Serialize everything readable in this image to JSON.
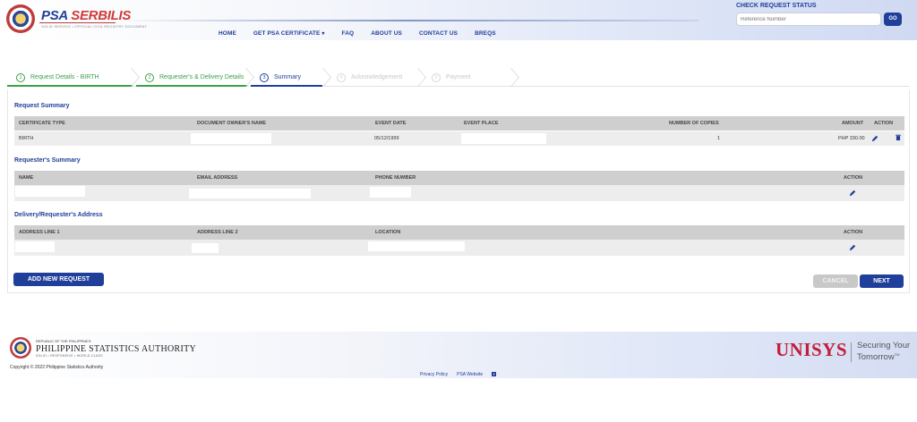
{
  "header": {
    "brand_psa": "PSA",
    "brand_serbilis": "SERBILIS",
    "brand_tagline": "SOLID SERVICE • OFFICIAL CIVIL REGISTRY DOCUMENT",
    "nav": [
      {
        "label": "HOME"
      },
      {
        "label": "GET PSA CERTIFICATE"
      },
      {
        "label": "FAQ"
      },
      {
        "label": "ABOUT US"
      },
      {
        "label": "CONTACT US"
      },
      {
        "label": "BREQS"
      }
    ],
    "check_status_title": "CHECK REQUEST STATUS",
    "reference_placeholder": "Reference Number",
    "go_label": "GO"
  },
  "steps": [
    {
      "num": "1",
      "label": "Request Details - BIRTH",
      "state": "done"
    },
    {
      "num": "2",
      "label": "Requester's & Delivery Details",
      "state": "done"
    },
    {
      "num": "3",
      "label": "Summary",
      "state": "active"
    },
    {
      "num": "4",
      "label": "Acknowledgement",
      "state": "pending"
    },
    {
      "num": "5",
      "label": "Payment",
      "state": "pending"
    }
  ],
  "request_summary": {
    "title": "Request Summary",
    "headers": [
      "CERTIFICATE TYPE",
      "DOCUMENT OWNER'S NAME",
      "EVENT DATE",
      "EVENT PLACE",
      "NUMBER OF COPIES",
      "AMOUNT",
      "ACTION"
    ],
    "row": {
      "certificate_type": "BIRTH",
      "event_date": "05/12/1999",
      "copies": "1",
      "amount": "PHP 330.00"
    }
  },
  "requester_summary": {
    "title": "Requester's Summary",
    "headers": [
      "NAME",
      "EMAIL ADDRESS",
      "PHONE NUMBER",
      "ACTION"
    ]
  },
  "address_summary": {
    "title": "Delivery/Requester's Address",
    "headers": [
      "ADDRESS LINE 1",
      "ADDRESS LINE 2",
      "LOCATION",
      "ACTION"
    ]
  },
  "buttons": {
    "add_new_request": "ADD NEW REQUEST",
    "cancel": "CANCEL",
    "next": "NEXT"
  },
  "footer": {
    "republic": "REPUBLIC OF THE PHILIPPINES",
    "authority": "PHILIPPINE STATISTICS AUTHORITY",
    "motto": "SOLID • RESPONSIVE • WORLD-CLASS",
    "copyright": "Copyright © 2022 Philippine Statistics Authority",
    "links": [
      {
        "label": "Privacy Policy"
      },
      {
        "label": "PSA Website"
      }
    ],
    "fb_glyph": "f",
    "unisys": "UNISYS",
    "unisys_tag_1": "Securing Your",
    "unisys_tag_2": "Tomorrow",
    "unisys_tm": "TM"
  },
  "colors": {
    "primary": "#1f3f9a",
    "done": "#3aa04a",
    "brand_red": "#d23a3a",
    "unisys_red": "#c21e3a"
  }
}
